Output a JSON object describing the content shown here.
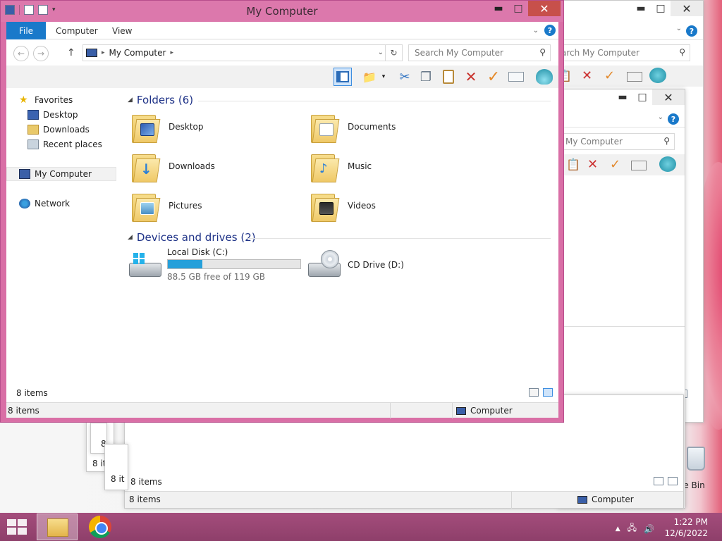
{
  "window": {
    "title": "My Computer",
    "minimize": "▬",
    "maximize": "□",
    "close": "✕"
  },
  "ribbon": {
    "tabs": [
      "File",
      "Computer",
      "View"
    ]
  },
  "address": {
    "path": "My Computer",
    "search_placeholder": "Search My Computer"
  },
  "nav_pane": {
    "favorites": "Favorites",
    "desktop": "Desktop",
    "downloads": "Downloads",
    "recent": "Recent places",
    "my_computer": "My Computer",
    "network": "Network"
  },
  "content": {
    "folders_header": "Folders (6)",
    "folders": [
      "Desktop",
      "Documents",
      "Downloads",
      "Music",
      "Pictures",
      "Videos"
    ],
    "devices_header": "Devices and drives (2)",
    "drives": [
      {
        "name": "Local Disk (C:)",
        "free_text": "88.5 GB free of 119 GB",
        "used_fraction": 0.26
      },
      {
        "name": "CD Drive (D:)"
      }
    ]
  },
  "status": {
    "pane_items": "8 items",
    "bar_items": "8 items",
    "location": "Computer"
  },
  "background_windows": {
    "search_text": "arch My Computer",
    "search_text2": "My Computer",
    "items": "8 items",
    "location": "Computer",
    "partial_items": [
      "8",
      "8 it",
      "8 it"
    ]
  },
  "desktop": {
    "recycle_label": "le Bin"
  },
  "taskbar": {
    "time": "1:22 PM",
    "date": "12/6/2022"
  },
  "colors": {
    "window_frame": "#d96fa6",
    "accent": "#1979ca",
    "group_header": "#1e3287",
    "taskbar": "#9a477a",
    "disk_fill": "#26a0da"
  }
}
